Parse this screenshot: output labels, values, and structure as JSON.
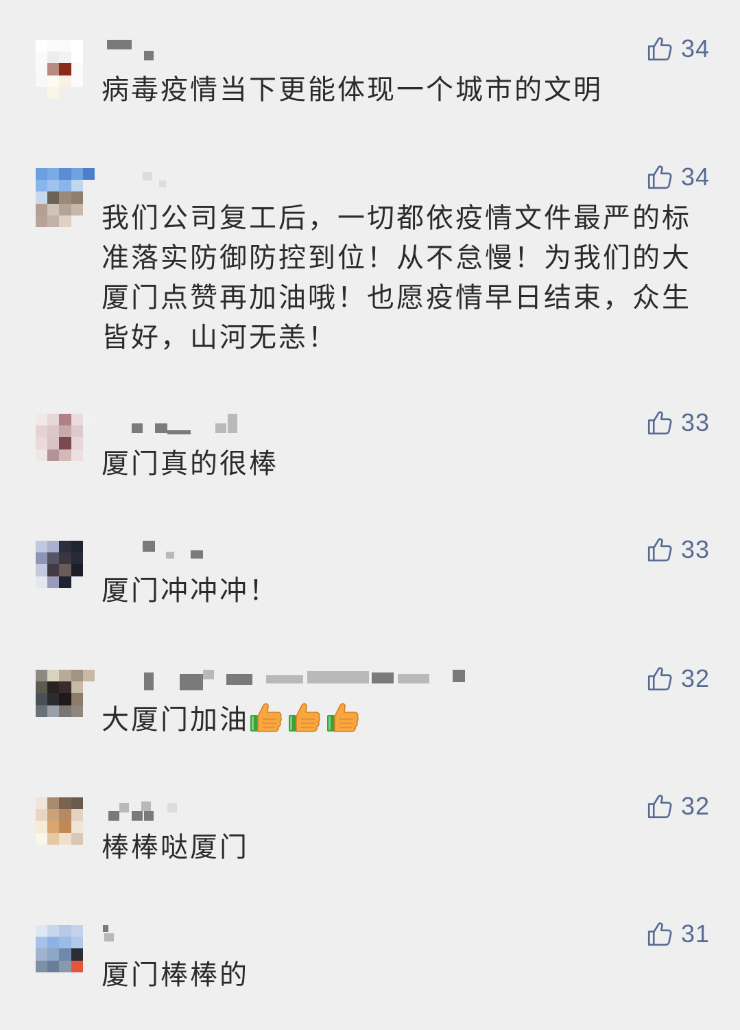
{
  "colors": {
    "background": "#efefef",
    "text": "#2b2b2b",
    "like": "#576b95"
  },
  "comments": [
    {
      "text": "病毒疫情当下更能体现一个城市的文明",
      "likes": "34",
      "like_icon": "thumbs-up-outline-icon"
    },
    {
      "text": "我们公司复工后，一切都依疫情文件最严的标准落实防御防控到位！从不怠慢！为我们的大厦门点赞再加油哦！也愿疫情早日结束，众生皆好，山河无恙！",
      "likes": "34",
      "like_icon": "thumbs-up-outline-icon"
    },
    {
      "text": "厦门真的很棒",
      "likes": "33",
      "like_icon": "thumbs-up-outline-icon"
    },
    {
      "text": "厦门冲冲冲！",
      "likes": "33",
      "like_icon": "thumbs-up-outline-icon"
    },
    {
      "text": "大厦门加油",
      "emoji": [
        "thumbs-up-emoji",
        "thumbs-up-emoji",
        "thumbs-up-emoji"
      ],
      "likes": "32",
      "like_icon": "thumbs-up-outline-icon"
    },
    {
      "text": "棒棒哒厦门",
      "likes": "32",
      "like_icon": "thumbs-up-outline-icon"
    },
    {
      "text": "厦门棒棒的",
      "likes": "31",
      "like_icon": "thumbs-up-outline-icon"
    }
  ]
}
